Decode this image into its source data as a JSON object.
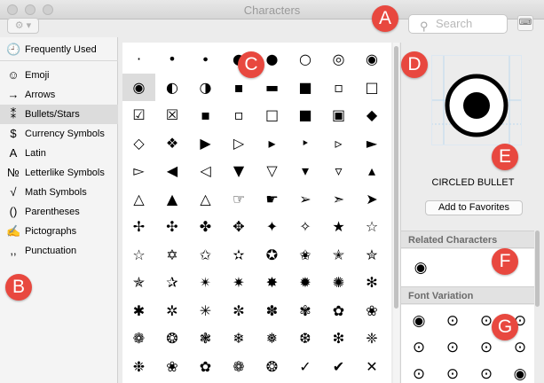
{
  "window": {
    "title": "Characters"
  },
  "toolbar": {
    "search_placeholder": "Search",
    "gear_label": "⚙ ▾",
    "keyboard_label": "⌨"
  },
  "sidebar": {
    "items": [
      {
        "icon": "🕘",
        "label": "Frequently Used",
        "icon_name": "clock-icon"
      },
      {
        "icon": "☺",
        "label": "Emoji",
        "icon_name": "smiley-icon"
      },
      {
        "icon": "→",
        "label": "Arrows",
        "icon_name": "arrow-icon"
      },
      {
        "icon": "⁑",
        "label": "Bullets/Stars",
        "icon_name": "asterisk-icon",
        "active": true
      },
      {
        "icon": "$",
        "label": "Currency Symbols",
        "icon_name": "dollar-icon"
      },
      {
        "icon": "A",
        "label": "Latin",
        "icon_name": "letter-a-icon"
      },
      {
        "icon": "№",
        "label": "Letterlike Symbols",
        "icon_name": "numero-icon"
      },
      {
        "icon": "√",
        "label": "Math Symbols",
        "icon_name": "square-root-icon"
      },
      {
        "icon": "()",
        "label": "Parentheses",
        "icon_name": "parentheses-icon"
      },
      {
        "icon": "✍",
        "label": "Pictographs",
        "icon_name": "writing-hand-icon"
      },
      {
        "icon": ",,",
        "label": "Punctuation",
        "icon_name": "comma-icon"
      }
    ]
  },
  "grid": {
    "rows": [
      [
        "·",
        "•",
        "∙",
        "●",
        "●",
        "○",
        "◎",
        "◉"
      ],
      [
        "◉",
        "◐",
        "◑",
        "▪",
        "▬",
        "■",
        "▫",
        "□"
      ],
      [
        "☑",
        "☒",
        "▪",
        "▫",
        "□",
        "■",
        "▣",
        "◆"
      ],
      [
        "◇",
        "❖",
        "▶",
        "▷",
        "▸",
        "‣",
        "▹",
        "►"
      ],
      [
        "▻",
        "◀",
        "◁",
        "▼",
        "▽",
        "▾",
        "▿",
        "▴"
      ],
      [
        "△",
        "▲",
        "△",
        "☞",
        "☛",
        "➢",
        "➣",
        "➤"
      ],
      [
        "✢",
        "✣",
        "✤",
        "✥",
        "✦",
        "✧",
        "★",
        "☆"
      ],
      [
        "☆",
        "✡",
        "✩",
        "✫",
        "✪",
        "✬",
        "✭",
        "✮"
      ],
      [
        "✯",
        "✰",
        "✴",
        "✷",
        "✸",
        "✹",
        "✺",
        "✻"
      ],
      [
        "✱",
        "✲",
        "✳",
        "✼",
        "✽",
        "✾",
        "✿",
        "❀"
      ],
      [
        "❁",
        "❂",
        "❃",
        "❄",
        "❅",
        "❆",
        "❇",
        "❈"
      ],
      [
        "❉",
        "❀",
        "✿",
        "❁",
        "❂",
        "✓",
        "✔",
        "✕"
      ]
    ]
  },
  "detail": {
    "preview_char": "◉",
    "char_name": "CIRCLED BULLET",
    "favorites_button": "Add to Favorites",
    "related_heading": "Related Characters",
    "related_chars": [
      "◉"
    ],
    "font_variation_heading": "Font Variation",
    "font_variations": [
      "◉",
      "⊙",
      "⊙",
      "⊙",
      "⊙",
      "⊙",
      "⊙",
      "⊙",
      "⊙",
      "⊙",
      "⊙",
      "◉"
    ]
  },
  "callouts": [
    "A",
    "B",
    "C",
    "D",
    "E",
    "F",
    "G"
  ],
  "colors": {
    "callout": "#e8483f",
    "selected_bg": "#dcdcdc"
  }
}
